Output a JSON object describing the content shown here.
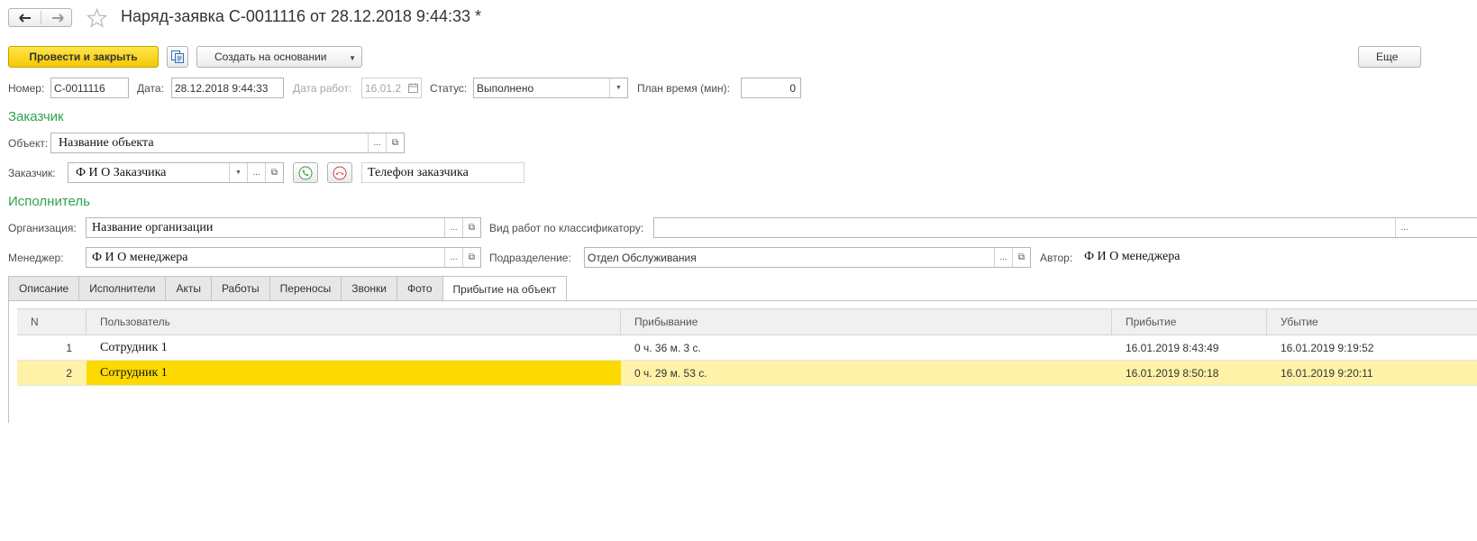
{
  "window": {
    "title": "Наряд-заявка С-0011116 от 28.12.2018 9:44:33 *",
    "back_icon": "arrow-left-icon",
    "forward_icon": "arrow-right-icon",
    "favorite_icon": "star-icon"
  },
  "toolbar": {
    "post_and_close_label": "Провести и закрыть",
    "structure_icon": "document-structure-icon",
    "create_based_label": "Создать на основании",
    "more_label": "Еще"
  },
  "header": {
    "number_label": "Номер:",
    "number_value": "С-0011116",
    "date_label": "Дата:",
    "date_value": "28.12.2018  9:44:33",
    "work_date_label": "Дата работ:",
    "work_date_value": "16.01.2",
    "status_label": "Статус:",
    "status_value": "Выполнено",
    "plan_time_label": "План время (мин):",
    "plan_time_value": "0"
  },
  "customer": {
    "section_title": "Заказчик",
    "object_label": "Объект:",
    "object_value": "Название объекта",
    "customer_label": "Заказчик:",
    "customer_value": "Ф И О Заказчика",
    "phone_value": "Телефон заказчика"
  },
  "executor": {
    "section_title": "Исполнитель",
    "org_label": "Организация:",
    "org_value": "Название организации",
    "work_type_label": "Вид работ по классификатору:",
    "work_type_value": "",
    "manager_label": "Менеджер:",
    "manager_value": "Ф И О менеджера",
    "department_label": "Подразделение:",
    "department_value": "Отдел Обслуживания",
    "author_label": "Автор:",
    "author_value": "Ф И О менеджера"
  },
  "tabs": [
    "Описание",
    "Исполнители",
    "Акты",
    "Работы",
    "Переносы",
    "Звонки",
    "Фото",
    "Прибытие на объект"
  ],
  "active_tab_index": 7,
  "table": {
    "columns": [
      "N",
      "Пользователь",
      "Прибывание",
      "Прибытие",
      "Убытие"
    ],
    "rows": [
      {
        "n": "1",
        "user": "Сотрудник 1",
        "stay": "0 ч. 36 м. 3 с.",
        "arrival": "16.01.2019 8:43:49",
        "departure": "16.01.2019 9:19:52"
      },
      {
        "n": "2",
        "user": "Сотрудник 1",
        "stay": "0 ч. 29 м. 53 с.",
        "arrival": "16.01.2019 8:50:18",
        "departure": "16.01.2019 9:20:11"
      }
    ],
    "selected_row_index": 1
  },
  "colors": {
    "primary_button": "#f5c800",
    "section_title": "#2fa34b",
    "selected_row": "#fdf2a7",
    "selected_cell": "#fcd900"
  }
}
